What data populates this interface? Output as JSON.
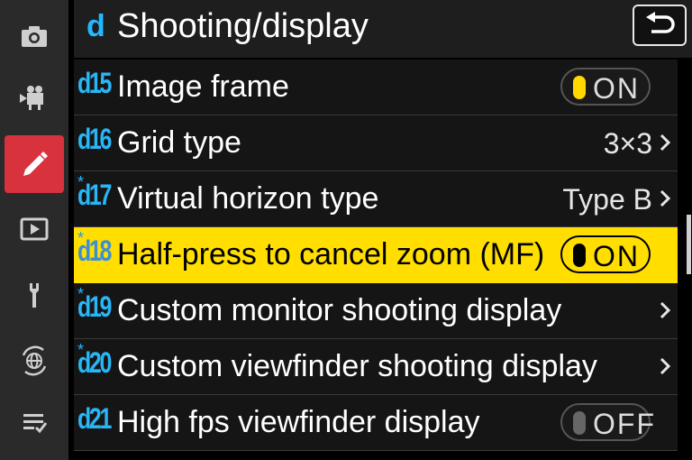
{
  "sidebar": {
    "items": [
      {
        "icon": "camera-icon"
      },
      {
        "icon": "movie-camera-icon"
      },
      {
        "icon": "pencil-icon",
        "active": true
      },
      {
        "icon": "playback-icon"
      },
      {
        "icon": "wrench-icon"
      },
      {
        "icon": "network-icon"
      },
      {
        "icon": "my-menu-icon"
      }
    ],
    "active_color": "#d8323c"
  },
  "header": {
    "menu_letter": "d",
    "title": "Shooting/display",
    "back_icon": "back-arrow-icon"
  },
  "menu": {
    "selected_color": "#ffde00",
    "code_color": "#29b6f6",
    "rows": [
      {
        "code": "d15",
        "star": "",
        "label": "Image frame",
        "toggle": "ON"
      },
      {
        "code": "d16",
        "star": "",
        "label": "Grid type",
        "value": "3×3",
        "chevron": true
      },
      {
        "code": "d17",
        "star": "*",
        "label": "Virtual horizon type",
        "value": "Type B",
        "chevron": true
      },
      {
        "code": "d18",
        "star": "*",
        "label": "Half-press to cancel zoom (MF)",
        "toggle": "ON",
        "selected": true
      },
      {
        "code": "d19",
        "star": "*",
        "label": "Custom monitor shooting display",
        "chevron": true
      },
      {
        "code": "d20",
        "star": "*",
        "label": "Custom viewfinder shooting display",
        "chevron": true
      },
      {
        "code": "d21",
        "star": "",
        "label": "High fps viewfinder display",
        "toggle": "OFF"
      }
    ]
  },
  "scrollbar": {
    "position": 0.55
  }
}
